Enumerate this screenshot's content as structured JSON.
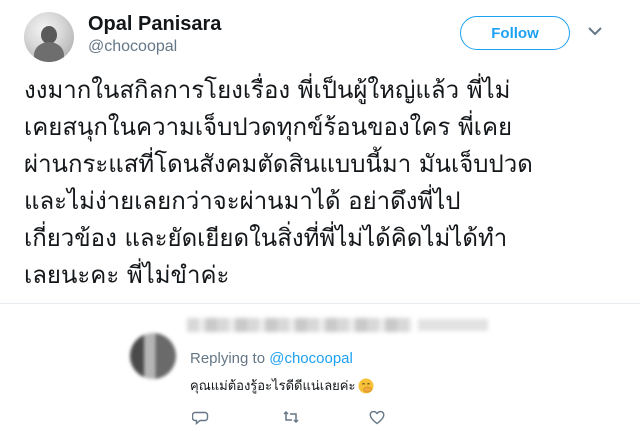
{
  "tweet": {
    "display_name": "Opal Panisara",
    "handle": "@chocoopal",
    "follow_label": "Follow",
    "lines": [
      "งงมากในสกิลการโยงเรื่อง พี่เป็นผู้ใหญ่แล้ว พี่ไม่",
      "เคยสนุกในความเจ็บปวดทุกข์ร้อนของใคร พี่เคย",
      "ผ่านกระแสที่โดนสังคมตัดสินแบบนี้มา มันเจ็บปวด",
      "และไม่ง่ายเลยกว่าจะผ่านมาได้ อย่าดึงพี่ไป",
      "เกี่ยวข้อง และยัดเยียดในสิ่งที่พี่ไม่ได้คิดไม่ได้ทำ",
      "เลยนะคะ พี่ไม่ขำค่ะ"
    ]
  },
  "reply": {
    "replying_prefix": "Replying to ",
    "replying_handle": "@chocoopal",
    "text": "คุณแม่ต้องรู้อะไรดีดีแน่เลยค่ะ",
    "emoji_icon": "face-with-hand-over-mouth-icon"
  },
  "colors": {
    "accent": "#1da1f2",
    "secondary_text": "#657786",
    "divider": "#e6ecf0"
  }
}
